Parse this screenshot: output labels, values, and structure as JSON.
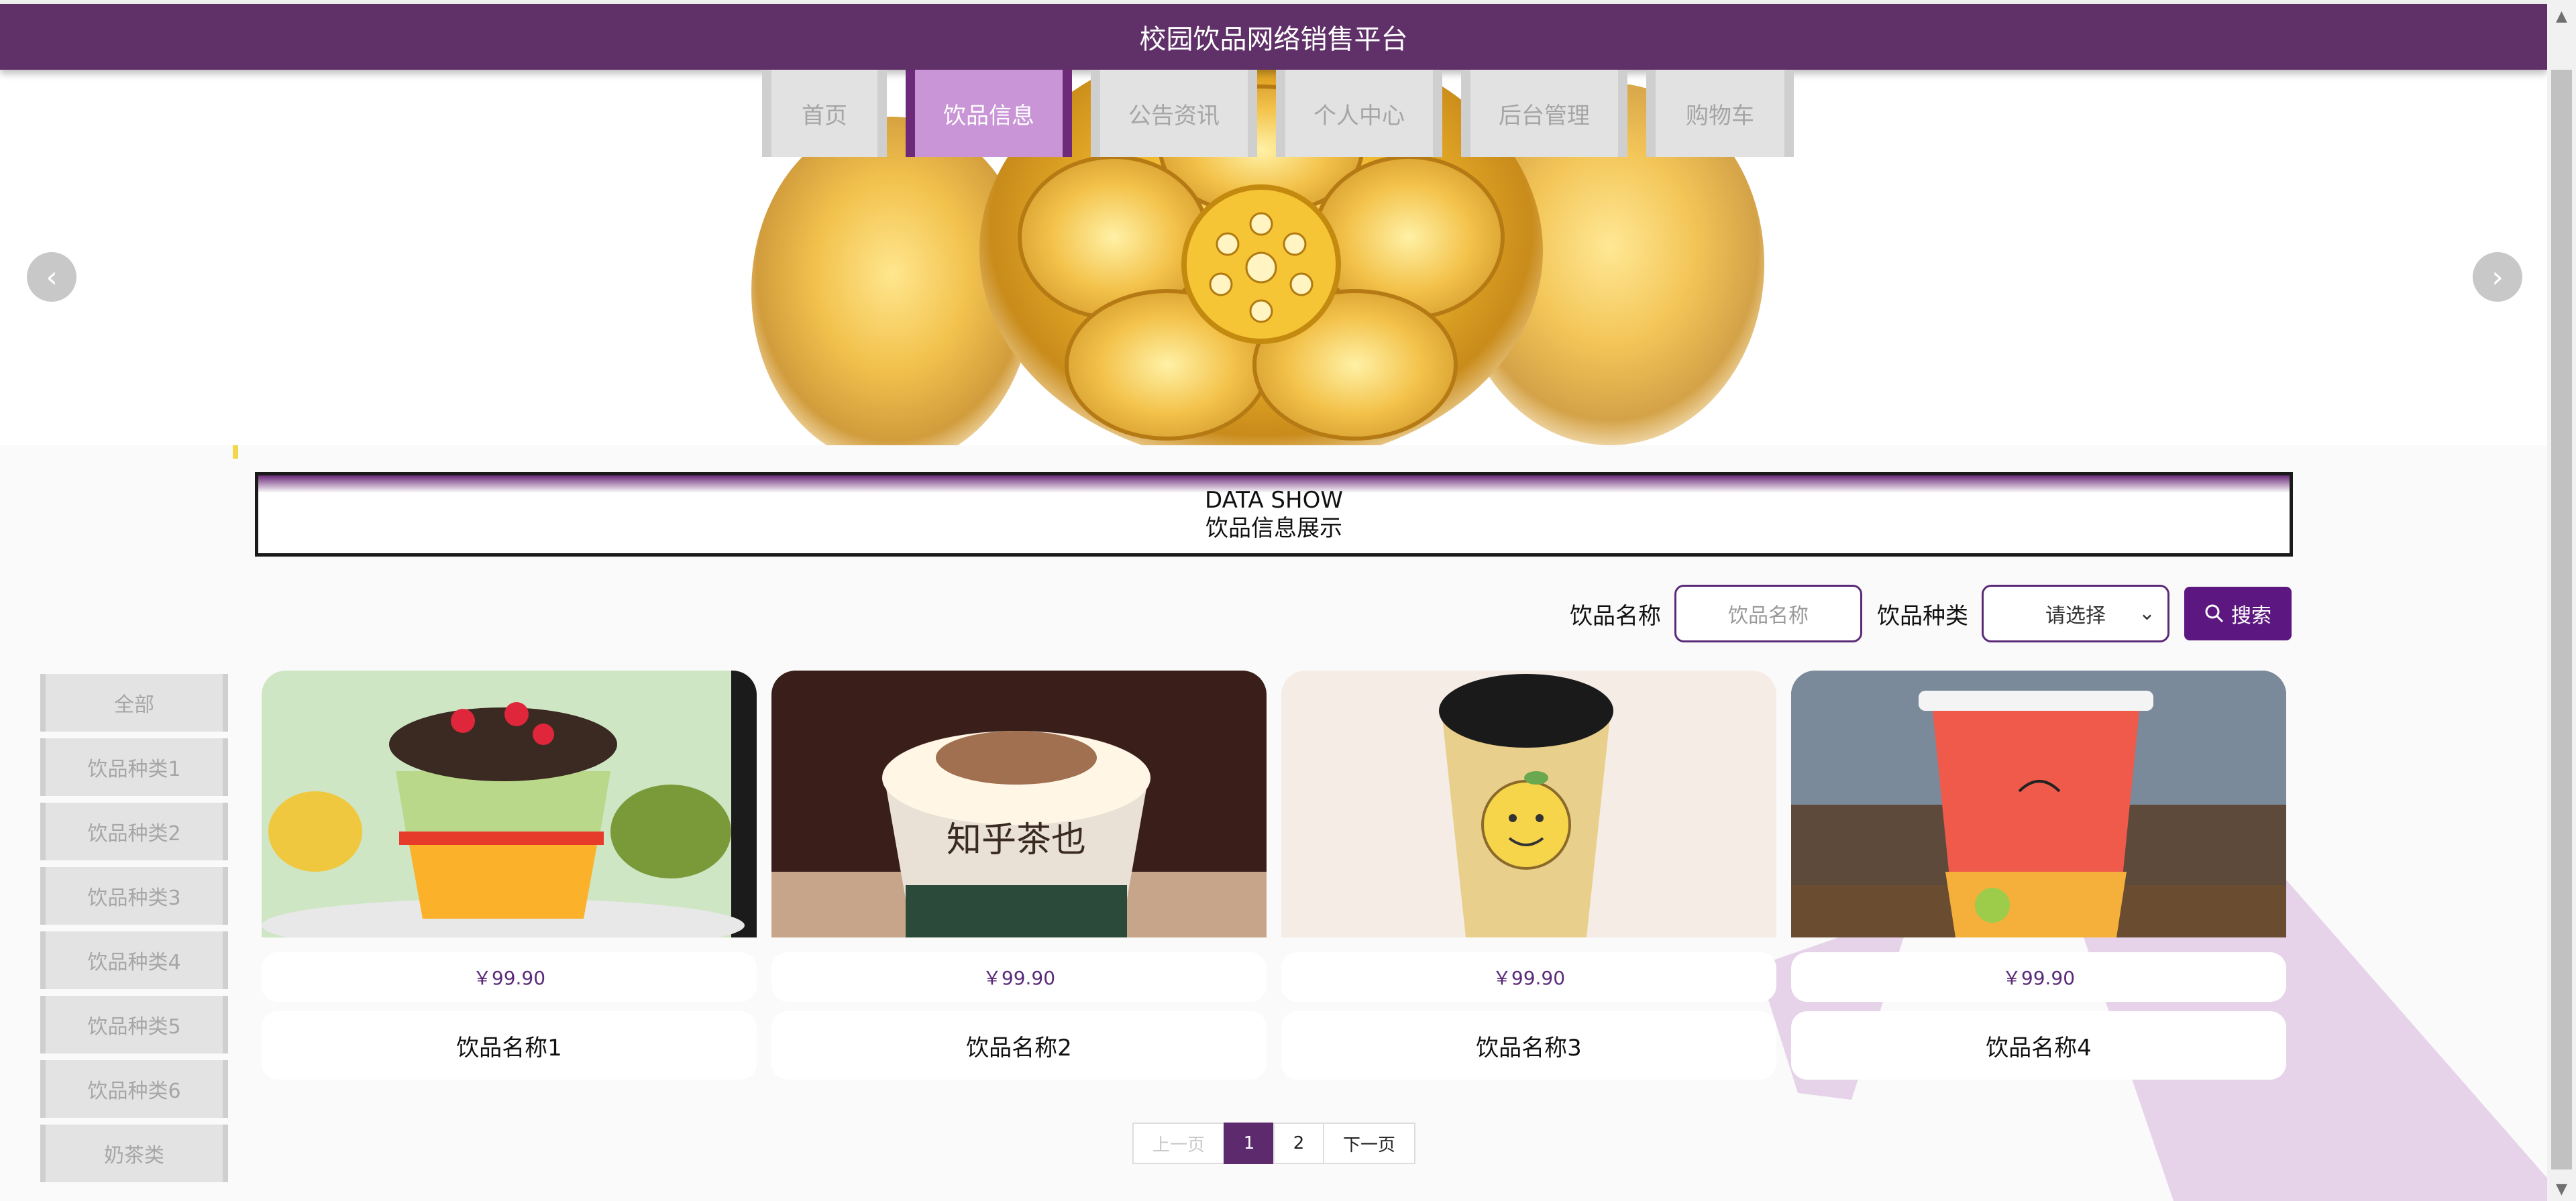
{
  "header": {
    "title": "校园饮品网络销售平台"
  },
  "nav": {
    "items": [
      {
        "label": "首页"
      },
      {
        "label": "饮品信息"
      },
      {
        "label": "公告资讯"
      },
      {
        "label": "个人中心"
      },
      {
        "label": "后台管理"
      },
      {
        "label": "购物车"
      }
    ]
  },
  "section": {
    "title_en": "DATA SHOW",
    "title_cn": "饮品信息展示"
  },
  "search": {
    "name_label": "饮品名称",
    "name_placeholder": "饮品名称",
    "type_label": "饮品种类",
    "type_selected": "请选择",
    "button_label": "搜索"
  },
  "categories": [
    "全部",
    "饮品种类1",
    "饮品种类2",
    "饮品种类3",
    "饮品种类4",
    "饮品种类5",
    "饮品种类6",
    "奶茶类"
  ],
  "products": [
    {
      "price": "￥99.90",
      "name": "饮品名称1"
    },
    {
      "price": "￥99.90",
      "name": "饮品名称2"
    },
    {
      "price": "￥99.90",
      "name": "饮品名称3"
    },
    {
      "price": "￥99.90",
      "name": "饮品名称4"
    }
  ],
  "pager": {
    "prev": "上一页",
    "pages": [
      "1",
      "2"
    ],
    "next": "下一页"
  },
  "colors": {
    "brand": "#603068",
    "active_tab": "#c995d6",
    "button": "#5c1880"
  }
}
